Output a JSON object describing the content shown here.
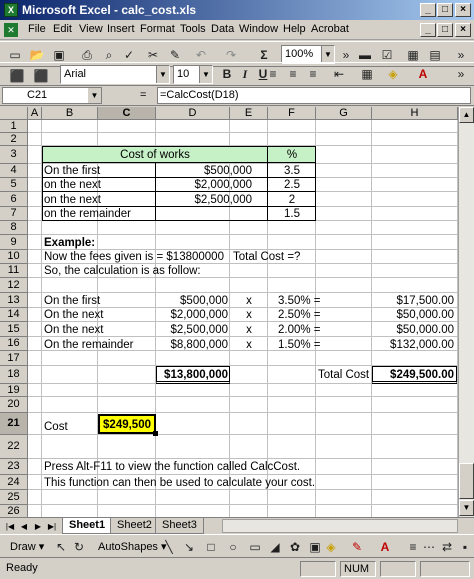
{
  "window": {
    "title": "Microsoft Excel - calc_cost.xls",
    "app_icon": "X"
  },
  "menu": [
    "File",
    "Edit",
    "View",
    "Insert",
    "Format",
    "Tools",
    "Data",
    "Window",
    "Help",
    "Acrobat"
  ],
  "toolbar": {
    "zoom": "100%",
    "sigma": "Σ"
  },
  "format_toolbar": {
    "font": "Arial",
    "size": "10",
    "bold": "B",
    "italic": "I",
    "underline": "U"
  },
  "formula_bar": {
    "name_box": "C21",
    "formula": "=CalcCost(D18)",
    "eq_sign": "="
  },
  "columns": [
    "A",
    "B",
    "C",
    "D",
    "E",
    "F",
    "G",
    "H"
  ],
  "rows": [
    "1",
    "2",
    "3",
    "4",
    "5",
    "6",
    "7",
    "8",
    "9",
    "10",
    "11",
    "12",
    "13",
    "14",
    "15",
    "16",
    "17",
    "18",
    "19",
    "20",
    "21",
    "22",
    "23",
    "24",
    "25",
    "26"
  ],
  "cells": {
    "r3_header": "Cost of works",
    "r3_pct": "%",
    "r4_label": "On the first",
    "r4_amt": "$500,000",
    "r4_pct": "3.5",
    "r5_label": "on the next",
    "r5_amt": "$2,000,000",
    "r5_pct": "2.5",
    "r6_label": "on the next",
    "r6_amt": "$2,500,000",
    "r6_pct": "2",
    "r7_label": "on the remainder",
    "r7_pct": "1.5",
    "r9": "Example:",
    "r10a": "Now the fees given is = $13800000",
    "r10b": "Total Cost =?",
    "r11": "So, the calculation is as follow:",
    "r13_label": "On the first",
    "r13_amt": "$500,000",
    "r13_x": "x",
    "r13_pct": "3.50% =",
    "r13_res": "$17,500.00",
    "r14_label": "On the next",
    "r14_amt": "$2,000,000",
    "r14_x": "x",
    "r14_pct": "2.50% =",
    "r14_res": "$50,000.00",
    "r15_label": "On the next",
    "r15_amt": "$2,500,000",
    "r15_x": "x",
    "r15_pct": "2.00% =",
    "r15_res": "$50,000.00",
    "r16_label": "On the remainder",
    "r16_amt": "$8,800,000",
    "r16_x": "x",
    "r16_pct": "1.50% =",
    "r16_res": "$132,000.00",
    "r18_total": "$13,800,000",
    "r18_label": "Total Cost",
    "r18_cost": "$249,500.00",
    "r21_label": "Cost",
    "r21_value": "$249,500",
    "r23": "Press Alt-F11 to view the function called CalcCost.",
    "r24": "This function can then be used to calculate your cost."
  },
  "sheets": [
    "Sheet1",
    "Sheet2",
    "Sheet3"
  ],
  "drawing": {
    "draw": "Draw ▾",
    "autoshapes": "AutoShapes ▾"
  },
  "status": {
    "ready": "Ready",
    "num": "NUM"
  },
  "colors": {
    "table_header": "#c6f0c6",
    "selected_cell": "#ffff00",
    "title_blue": "#0a246a"
  }
}
